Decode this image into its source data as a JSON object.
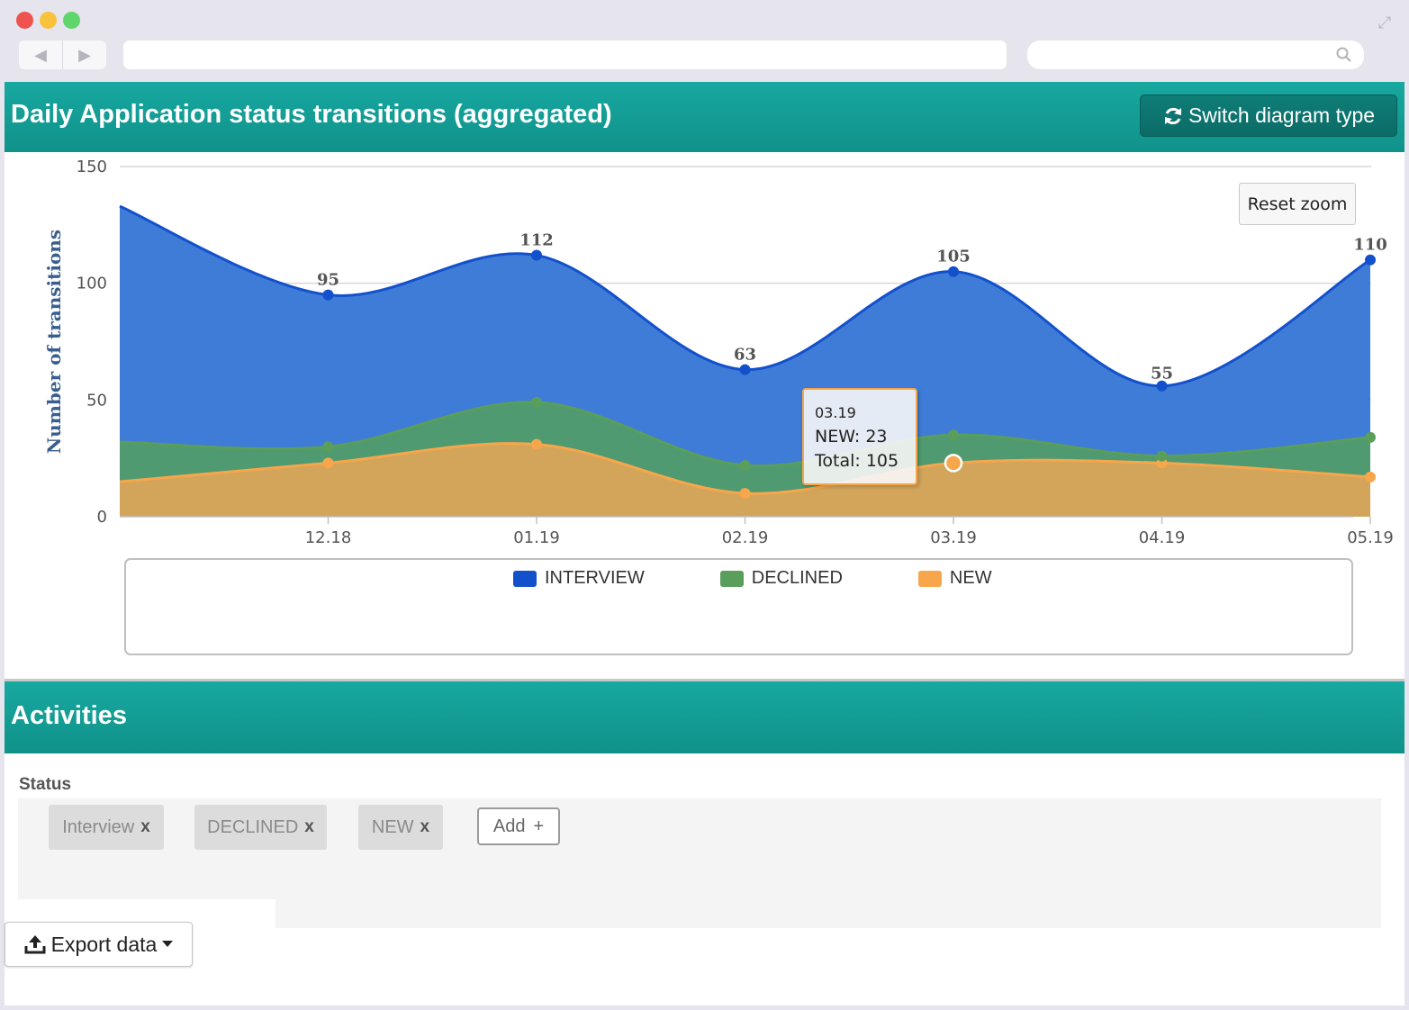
{
  "header": {
    "title": "Daily Application status transitions (aggregated)",
    "switch_button": "Switch diagram type"
  },
  "chart": {
    "reset_zoom": "Reset zoom",
    "tooltip": {
      "date": "03.19",
      "series_line": "NEW: 23",
      "total_line": "Total: 105"
    }
  },
  "chart_data": {
    "type": "area",
    "stacked": true,
    "ylabel": "Number of transitions",
    "xlabel": "",
    "ylim": [
      0,
      150
    ],
    "yticks": [
      0,
      50,
      100,
      150
    ],
    "x_tick_labels": [
      "12.18",
      "01.19",
      "02.19",
      "03.19",
      "04.19",
      "05.19"
    ],
    "x": [
      0,
      1,
      2,
      3,
      4,
      5,
      6
    ],
    "series": [
      {
        "name": "NEW",
        "color": "#f7a64c",
        "values": [
          15,
          23,
          31,
          10,
          23,
          23,
          17
        ]
      },
      {
        "name": "DECLINED",
        "color": "#5a9e5c",
        "values": [
          17,
          7,
          18,
          12,
          12,
          3,
          17
        ]
      },
      {
        "name": "INTERVIEW",
        "color": "#1351cc",
        "values": [
          101,
          65,
          63,
          41,
          70,
          30,
          76
        ]
      }
    ],
    "totals": [
      133,
      95,
      112,
      63,
      105,
      55,
      110
    ],
    "total_labels": [
      "",
      "95",
      "112",
      "63",
      "105",
      "55",
      "110"
    ],
    "legend_placement": "bottom",
    "grid": true
  },
  "legend": [
    {
      "label": "INTERVIEW",
      "color": "#1351cc"
    },
    {
      "label": "DECLINED",
      "color": "#5a9e5c"
    },
    {
      "label": "NEW",
      "color": "#f7a64c"
    }
  ],
  "activities": {
    "title": "Activities",
    "status_label": "Status",
    "tags": [
      {
        "label": "Interview",
        "remove": "x"
      },
      {
        "label": "DECLINED",
        "remove": "x"
      },
      {
        "label": "NEW",
        "remove": "x"
      }
    ],
    "add_button": "Add",
    "add_icon": "+"
  },
  "export": {
    "label": "Export data"
  },
  "icons": {
    "switch": "refresh-icon",
    "export": "upload-icon",
    "dropdown": "caret-down-icon",
    "search": "search-icon",
    "expand": "expand-icon"
  }
}
